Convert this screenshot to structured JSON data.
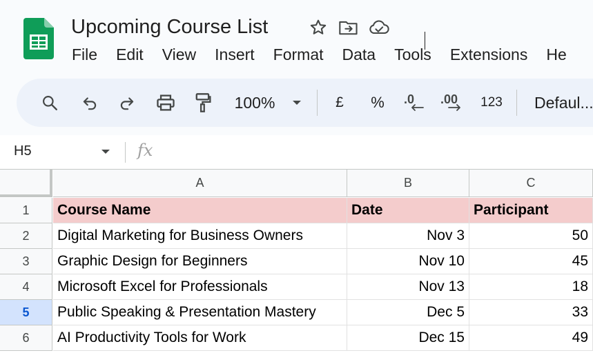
{
  "document": {
    "title": "Upcoming Course List",
    "icons": [
      "star-icon",
      "move-to-folder-icon",
      "cloud-saved-icon"
    ]
  },
  "menu": [
    "File",
    "Edit",
    "View",
    "Insert",
    "Format",
    "Data",
    "Tools",
    "Extensions",
    "He"
  ],
  "toolbar": {
    "zoom": "100%",
    "currency": "£",
    "percent": "%",
    "number_format": "123",
    "font": "Defaul..."
  },
  "formula_bar": {
    "cell_ref": "H5",
    "fx": "fx",
    "content": ""
  },
  "sheet": {
    "columns": [
      "A",
      "B",
      "C"
    ],
    "rows": [
      {
        "num": "1",
        "cells": [
          "Course Name",
          "Date",
          "Participant"
        ],
        "header": true
      },
      {
        "num": "2",
        "cells": [
          "Digital Marketing for Business Owners",
          "Nov 3",
          "50"
        ]
      },
      {
        "num": "3",
        "cells": [
          "Graphic Design for Beginners",
          "Nov 10",
          "45"
        ]
      },
      {
        "num": "4",
        "cells": [
          "Microsoft Excel for Professionals",
          "Nov 13",
          "18"
        ]
      },
      {
        "num": "5",
        "cells": [
          "Public Speaking & Presentation Mastery",
          "Dec 5",
          "33"
        ],
        "active": true
      },
      {
        "num": "6",
        "cells": [
          "AI Productivity Tools for Work",
          "Dec 15",
          "49"
        ]
      }
    ]
  },
  "colors": {
    "header_fill": "#f4cccc",
    "active_row_header": "#d3e3fd",
    "logo_green": "#0f9d58"
  }
}
